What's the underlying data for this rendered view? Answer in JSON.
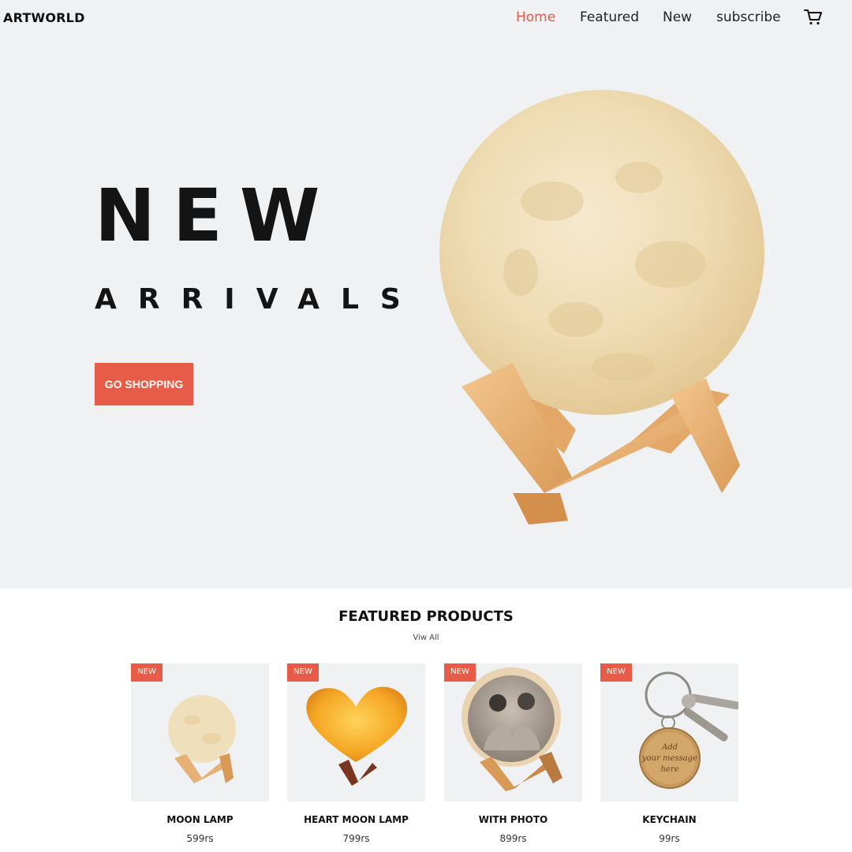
{
  "header": {
    "logo": "ARTWORLD",
    "nav": [
      "Home",
      "Featured",
      "New",
      "subscribe"
    ],
    "active": "Home",
    "cart_icon": "cart-icon"
  },
  "hero": {
    "title": "NEW",
    "subtitle": "ARRIVALS",
    "cta_label": "GO SHOPPING"
  },
  "featured": {
    "title": "FEATURED PRODUCTS",
    "view_all": "Viw All",
    "products": [
      {
        "badge": "NEW",
        "name": "MOON LAMP",
        "price": "599rs"
      },
      {
        "badge": "NEW",
        "name": "HEART MOON LAMP",
        "price": "799rs"
      },
      {
        "badge": "NEW",
        "name": "WITH PHOTO",
        "price": "899rs"
      },
      {
        "badge": "NEW",
        "name": "KEYCHAIN",
        "price": "99rs"
      }
    ]
  },
  "colors": {
    "accent": "#e75c49",
    "hero_bg": "#eff1f3",
    "text": "#111111"
  }
}
